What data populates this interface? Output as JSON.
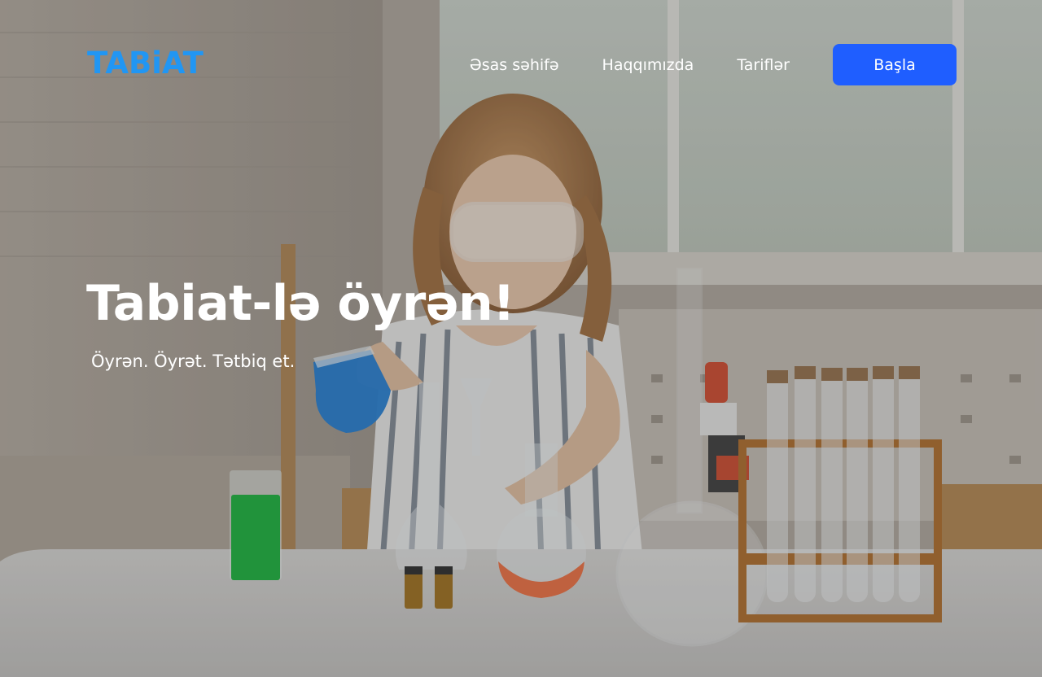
{
  "brand": {
    "logo_text": "TABiAT",
    "logo_color": "#2196f3"
  },
  "nav": {
    "links": [
      "Əsas səhifə",
      "Haqqımızda",
      "Tariflər"
    ],
    "cta_label": "Başla",
    "cta_color": "#1f5eff"
  },
  "hero": {
    "headline": "Tabiat-lə öyrən!",
    "subline": "Öyrən. Öyrət. Tətbiq et.",
    "background_image": "girl-doing-chemistry-experiment-photo"
  }
}
